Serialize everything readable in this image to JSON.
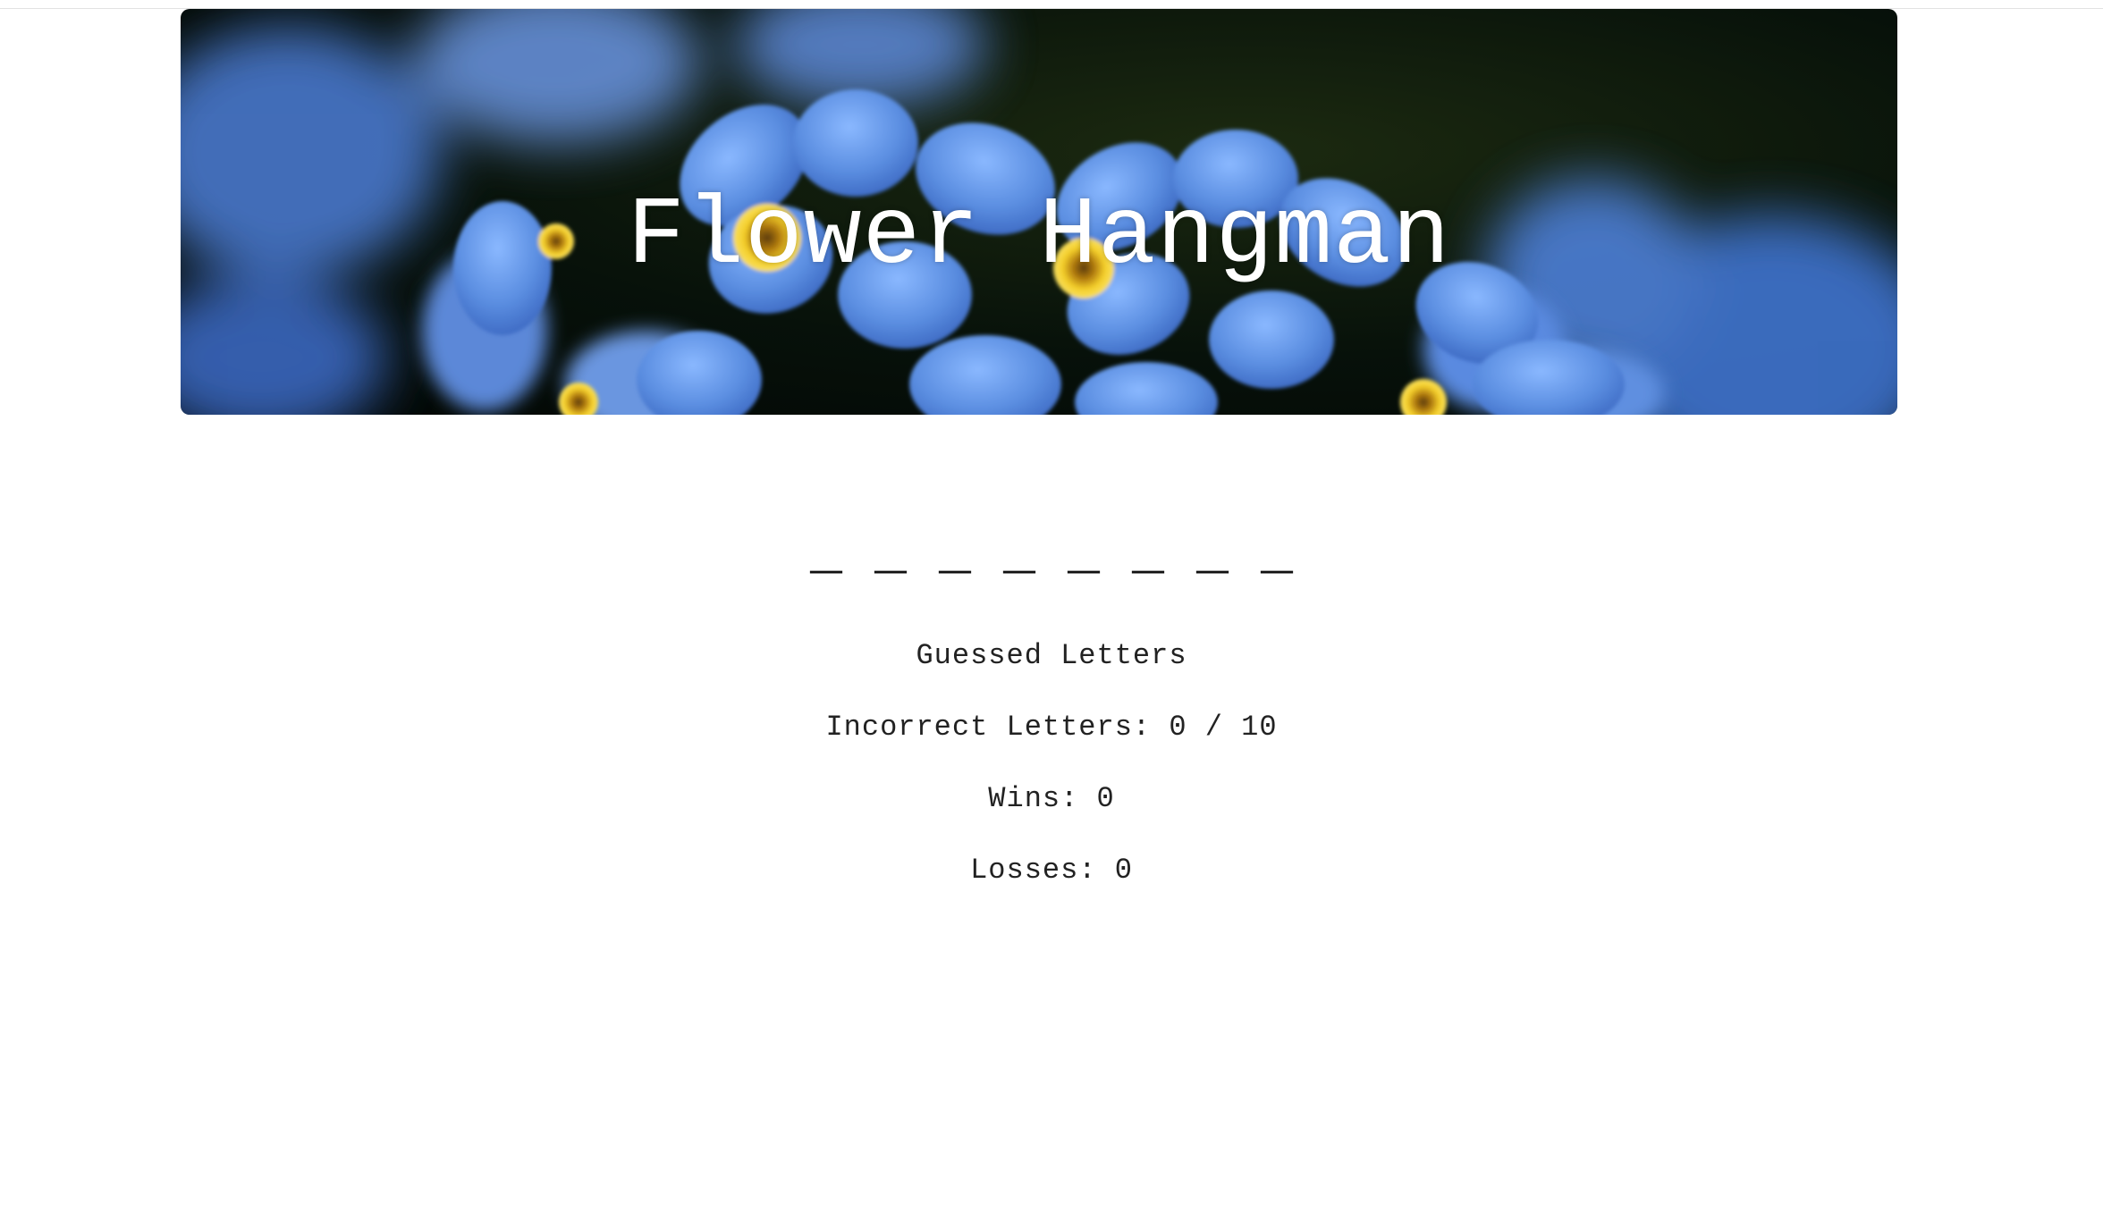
{
  "header": {
    "title": "Flower Hangman",
    "banner_image": "forget-me-not-flowers"
  },
  "game": {
    "word_blanks": "_ _ _ _ _ _ _ _",
    "guessed_letters_label": "Guessed Letters",
    "incorrect_letters": "Incorrect Letters: 0 / 10",
    "wins": "Wins: 0",
    "losses": "Losses: 0"
  },
  "colors": {
    "petal": "#5b8fe0",
    "flower_center": "#f0c020",
    "background": "#ffffff"
  }
}
